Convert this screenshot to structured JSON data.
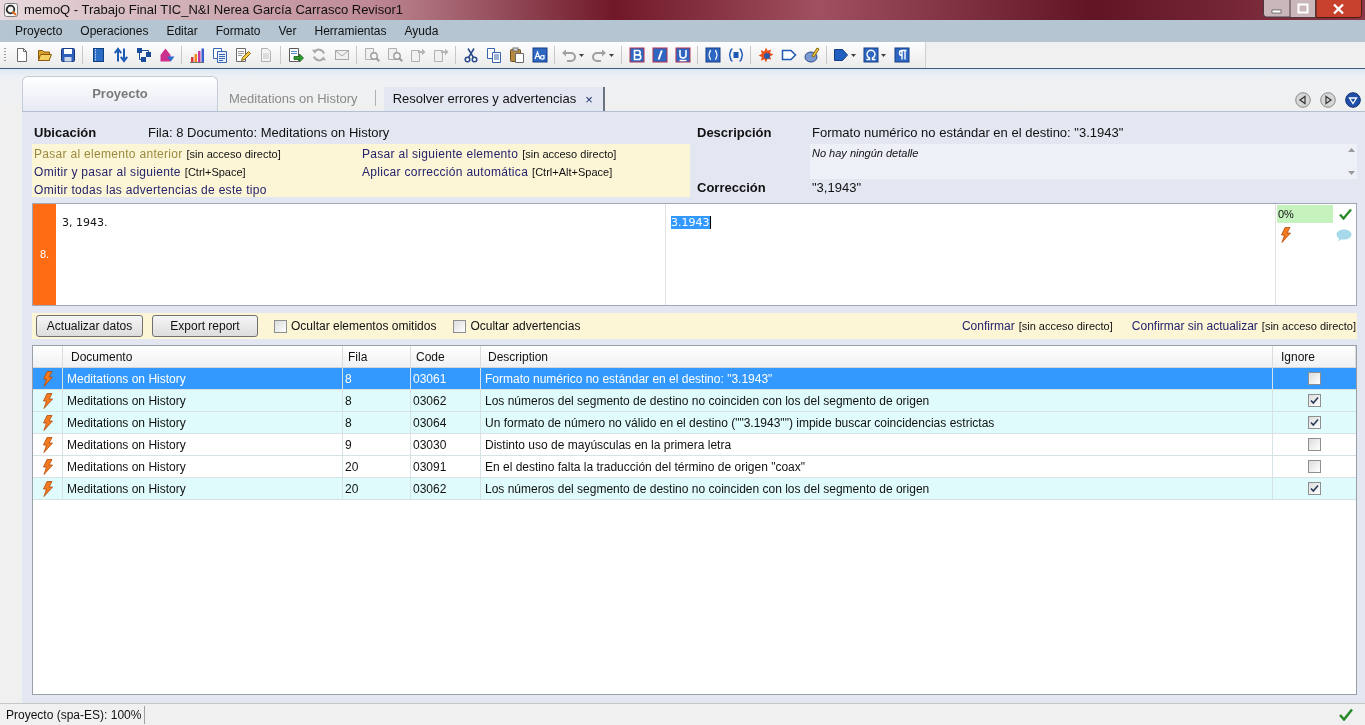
{
  "window": {
    "title": "memoQ - Trabajo Final TIC_N&I Nerea García Carrasco Revisor1"
  },
  "menu": [
    "Proyecto",
    "Operaciones",
    "Editar",
    "Formato",
    "Ver",
    "Herramientas",
    "Ayuda"
  ],
  "tabs": [
    {
      "kind": "home",
      "label": "Proyecto",
      "selected": false
    },
    {
      "kind": "document",
      "label": "Meditations on History",
      "selected": false
    },
    {
      "kind": "tool",
      "label": "Resolver errores y advertencias",
      "selected": true,
      "close": "×"
    }
  ],
  "location": {
    "label": "Ubicación",
    "value": "Fila: 8 Documento: Meditations on History"
  },
  "actions": [
    {
      "label": "Pasar al elemento anterior",
      "shortcut": "[sin acceso directo]",
      "disabled": true
    },
    {
      "label": "Pasar al siguiente elemento",
      "shortcut": "[sin acceso directo]",
      "disabled": false
    },
    {
      "label": "Omitir y pasar al siguiente",
      "shortcut": "[Ctrl+Space]",
      "disabled": false
    },
    {
      "label": "Aplicar corrección automática",
      "shortcut": "[Ctrl+Alt+Space]",
      "disabled": false
    },
    {
      "label": "Omitir todas las advertencias de este tipo",
      "disabled": false
    }
  ],
  "description": {
    "label": "Descripción",
    "value": "Formato numérico no estándar en el destino: \"3.1943\"",
    "details": "No hay ningún detalle"
  },
  "correction": {
    "label": "Corrección",
    "value": "\"3,1943\""
  },
  "segment": {
    "number": "8.",
    "source": "3, 1943.",
    "target": "3.1943",
    "target_selected": true,
    "match": "0%",
    "confirmed": true
  },
  "action_bar": {
    "buttons": [
      "Actualizar datos",
      "Export report"
    ],
    "checkboxes": [
      {
        "label": "Ocultar elementos omitidos",
        "checked": false
      },
      {
        "label": "Ocultar advertencias",
        "checked": false
      }
    ],
    "links": [
      {
        "label": "Confirmar",
        "shortcut": "[sin acceso directo]"
      },
      {
        "label": "Confirmar sin actualizar",
        "shortcut": "[sin acceso directo]"
      }
    ]
  },
  "table": {
    "columns": [
      "Documento",
      "Fila",
      "Code",
      "Description",
      "Ignore"
    ],
    "rows": [
      {
        "document": "Meditations on History",
        "row": "8",
        "code": "03061",
        "description": "Formato numérico no estándar en el destino: \"3.1943\"",
        "ignore": false,
        "selected": true
      },
      {
        "document": "Meditations on History",
        "row": "8",
        "code": "03062",
        "description": "Los números del segmento de destino no coinciden con los del segmento de origen",
        "ignore": true,
        "selected": false
      },
      {
        "document": "Meditations on History",
        "row": "8",
        "code": "03064",
        "description": "Un formato de número no válido en el destino (\"\"3.1943\"\") impide buscar coincidencias estrictas",
        "ignore": true,
        "selected": false
      },
      {
        "document": "Meditations on History",
        "row": "9",
        "code": "03030",
        "description": "Distinto uso de mayúsculas en la primera letra",
        "ignore": false,
        "selected": false
      },
      {
        "document": "Meditations on History",
        "row": "20",
        "code": "03091",
        "description": "En el destino falta la traducción del término de origen \"coax\"",
        "ignore": false,
        "selected": false
      },
      {
        "document": "Meditations on History",
        "row": "20",
        "code": "03062",
        "description": "Los números del segmento de destino no coinciden con los del segmento de origen",
        "ignore": true,
        "selected": false
      }
    ]
  },
  "status_bar": {
    "text": "Proyecto (spa-ES): 100%"
  }
}
